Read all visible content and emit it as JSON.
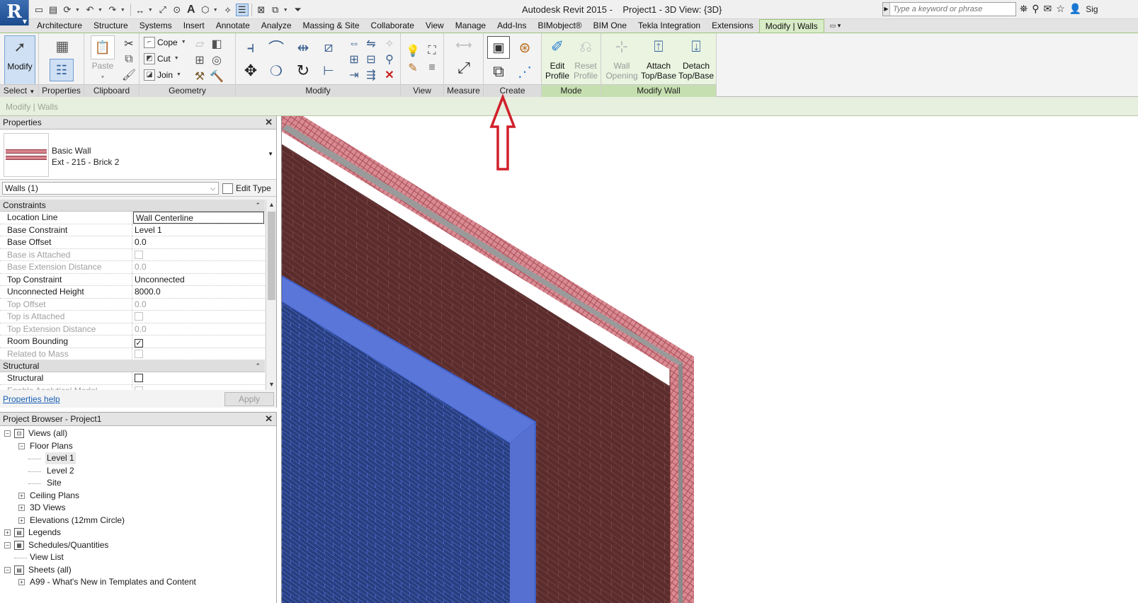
{
  "window": {
    "title": "Autodesk Revit 2015 -    Project1 - 3D View: {3D}",
    "search_placeholder": "Type a keyword or phrase",
    "sign_in_label": "Sig"
  },
  "qat_icons": [
    "open-icon",
    "save-icon",
    "sync-icon",
    "undo-icon",
    "redo-icon",
    "measure-icon",
    "dimension-icon",
    "text-icon",
    "3d-view-icon",
    "thin-lines-icon",
    "close-views-icon",
    "switch-windows-icon",
    "customize-icon"
  ],
  "tabs": [
    {
      "label": "Architecture"
    },
    {
      "label": "Structure"
    },
    {
      "label": "Systems"
    },
    {
      "label": "Insert"
    },
    {
      "label": "Annotate"
    },
    {
      "label": "Analyze"
    },
    {
      "label": "Massing & Site"
    },
    {
      "label": "Collaborate"
    },
    {
      "label": "View"
    },
    {
      "label": "Manage"
    },
    {
      "label": "Add-Ins"
    },
    {
      "label": "BIMobject®"
    },
    {
      "label": "BIM One"
    },
    {
      "label": "Tekla Integration"
    },
    {
      "label": "Extensions"
    },
    {
      "label": "Modify | Walls",
      "active": true
    }
  ],
  "ribbon": {
    "panels": {
      "select": "Select",
      "properties": "Properties",
      "clipboard": "Clipboard",
      "geometry": "Geometry",
      "modify": "Modify",
      "view": "View",
      "measure": "Measure",
      "create": "Create",
      "mode": "Mode",
      "modify_wall": "Modify Wall"
    },
    "modify_button": "Modify",
    "paste_button": "Paste",
    "geometry": {
      "cope": "Cope",
      "cut": "Cut",
      "join": "Join"
    },
    "mode": {
      "edit_profile": [
        "Edit",
        "Profile"
      ],
      "reset_profile": [
        "Reset",
        "Profile"
      ]
    },
    "modify_wall": {
      "wall_opening": [
        "Wall",
        "Opening"
      ],
      "attach": [
        "Attach",
        "Top/Base"
      ],
      "detach": [
        "Detach",
        "Top/Base"
      ]
    }
  },
  "options_bar": {
    "context": "Modify | Walls"
  },
  "properties": {
    "title": "Properties",
    "type_family": "Basic Wall",
    "type_name": "Ext - 215 - Brick 2",
    "instance_filter": "Walls (1)",
    "edit_type": "Edit Type",
    "groups": [
      {
        "name": "Constraints",
        "rows": [
          {
            "name": "Location Line",
            "value": "Wall Centerline",
            "state": "edit"
          },
          {
            "name": "Base Constraint",
            "value": "Level 1",
            "state": "normal"
          },
          {
            "name": "Base Offset",
            "value": "0.0",
            "state": "normal"
          },
          {
            "name": "Base is Attached",
            "value": "",
            "state": "disabled",
            "checkbox": false
          },
          {
            "name": "Base Extension Distance",
            "value": "0.0",
            "state": "disabled"
          },
          {
            "name": "Top Constraint",
            "value": "Unconnected",
            "state": "normal"
          },
          {
            "name": "Unconnected Height",
            "value": "8000.0",
            "state": "normal"
          },
          {
            "name": "Top Offset",
            "value": "0.0",
            "state": "disabled"
          },
          {
            "name": "Top is Attached",
            "value": "",
            "state": "disabled",
            "checkbox": false
          },
          {
            "name": "Top Extension Distance",
            "value": "0.0",
            "state": "disabled"
          },
          {
            "name": "Room Bounding",
            "value": "",
            "state": "normal",
            "checkbox": true
          },
          {
            "name": "Related to Mass",
            "value": "",
            "state": "disabled",
            "checkbox": false
          }
        ]
      },
      {
        "name": "Structural",
        "rows": [
          {
            "name": "Structural",
            "value": "",
            "state": "normal",
            "checkbox": false
          },
          {
            "name": "Enable Analytical Model",
            "value": "",
            "state": "disabled",
            "checkbox": false
          }
        ]
      }
    ],
    "help_link": "Properties help",
    "apply_button": "Apply"
  },
  "project_browser": {
    "title": "Project Browser - Project1",
    "tree": [
      {
        "label": "Views (all)",
        "depth": 0,
        "expander": "minus",
        "icon": "views-icon"
      },
      {
        "label": "Floor Plans",
        "depth": 1,
        "expander": "minus"
      },
      {
        "label": "Level 1",
        "depth": 2,
        "selected": true
      },
      {
        "label": "Level 2",
        "depth": 2
      },
      {
        "label": "Site",
        "depth": 2
      },
      {
        "label": "Ceiling Plans",
        "depth": 1,
        "expander": "plus"
      },
      {
        "label": "3D Views",
        "depth": 1,
        "expander": "plus"
      },
      {
        "label": "Elevations (12mm Circle)",
        "depth": 1,
        "expander": "plus"
      },
      {
        "label": "Legends",
        "depth": 0,
        "expander": "plus",
        "icon": "legends-icon"
      },
      {
        "label": "Schedules/Quantities",
        "depth": 0,
        "expander": "minus",
        "icon": "schedules-icon"
      },
      {
        "label": "View List",
        "depth": 1
      },
      {
        "label": "Sheets (all)",
        "depth": 0,
        "expander": "minus",
        "icon": "sheets-icon"
      },
      {
        "label": "A99 - What's New in Templates and Content",
        "depth": 1,
        "expander": "plus"
      }
    ]
  },
  "colors": {
    "brick_face": "#5a2c2c",
    "brick_cap": "#d98a92",
    "selected_wall": "#283f7e",
    "selection_highlight": "#3f5fc8",
    "annotation_arrow": "#d0202a",
    "contextual_tab": "#d9ecc8"
  }
}
